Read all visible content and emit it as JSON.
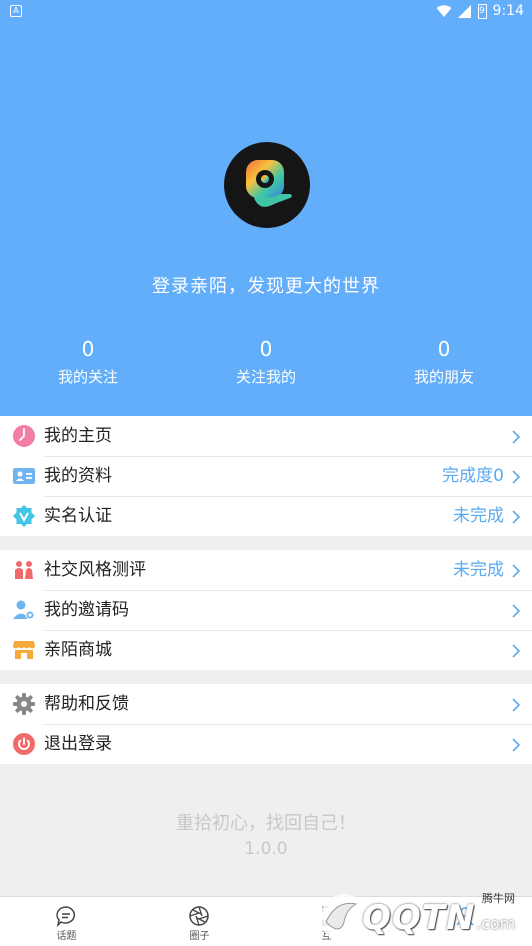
{
  "status_bar": {
    "sim_label": "A",
    "time": "9:14",
    "battery_level": "9"
  },
  "profile": {
    "login_prompt": "登录亲陌，发现更大的世界",
    "stats": [
      {
        "value": "0",
        "label": "我的关注"
      },
      {
        "value": "0",
        "label": "关注我的"
      },
      {
        "value": "0",
        "label": "我的朋友"
      }
    ]
  },
  "menu": {
    "group1": [
      {
        "label": "我的主页",
        "value": "",
        "icon": "clock-icon"
      },
      {
        "label": "我的资料",
        "value": "完成度0",
        "icon": "id-card-icon"
      },
      {
        "label": "实名认证",
        "value": "未完成",
        "icon": "verified-badge-icon"
      }
    ],
    "group2": [
      {
        "label": "社交风格测评",
        "value": "未完成",
        "icon": "people-icon"
      },
      {
        "label": "我的邀请码",
        "value": "",
        "icon": "user-invite-icon"
      },
      {
        "label": "亲陌商城",
        "value": "",
        "icon": "shop-icon"
      }
    ],
    "group3": [
      {
        "label": "帮助和反馈",
        "value": "",
        "icon": "gear-icon"
      },
      {
        "label": "退出登录",
        "value": "",
        "icon": "power-icon"
      }
    ]
  },
  "footer": {
    "slogan": "重拾初心，找回自己！",
    "version": "1.0.0"
  },
  "tabbar": {
    "tabs": [
      {
        "label": "话题",
        "icon": "chat-bubble-icon"
      },
      {
        "label": "圈子",
        "icon": "aperture-icon"
      },
      {
        "label": "互",
        "icon": "scan-icon"
      },
      {
        "label": "",
        "icon": "profile-icon"
      }
    ]
  },
  "watermark": {
    "text": "QQTN",
    "suffix": ".com",
    "site_name": "腾牛网"
  },
  "colors": {
    "header_bg": "#62aefb",
    "accent_value": "#5aaaf0",
    "icon_pink": "#f27fa3",
    "icon_blue": "#6fb6f1",
    "icon_cyan": "#43c6e6",
    "icon_red": "#f06a6a",
    "icon_orange": "#f7a93b",
    "icon_gray": "#888888"
  }
}
